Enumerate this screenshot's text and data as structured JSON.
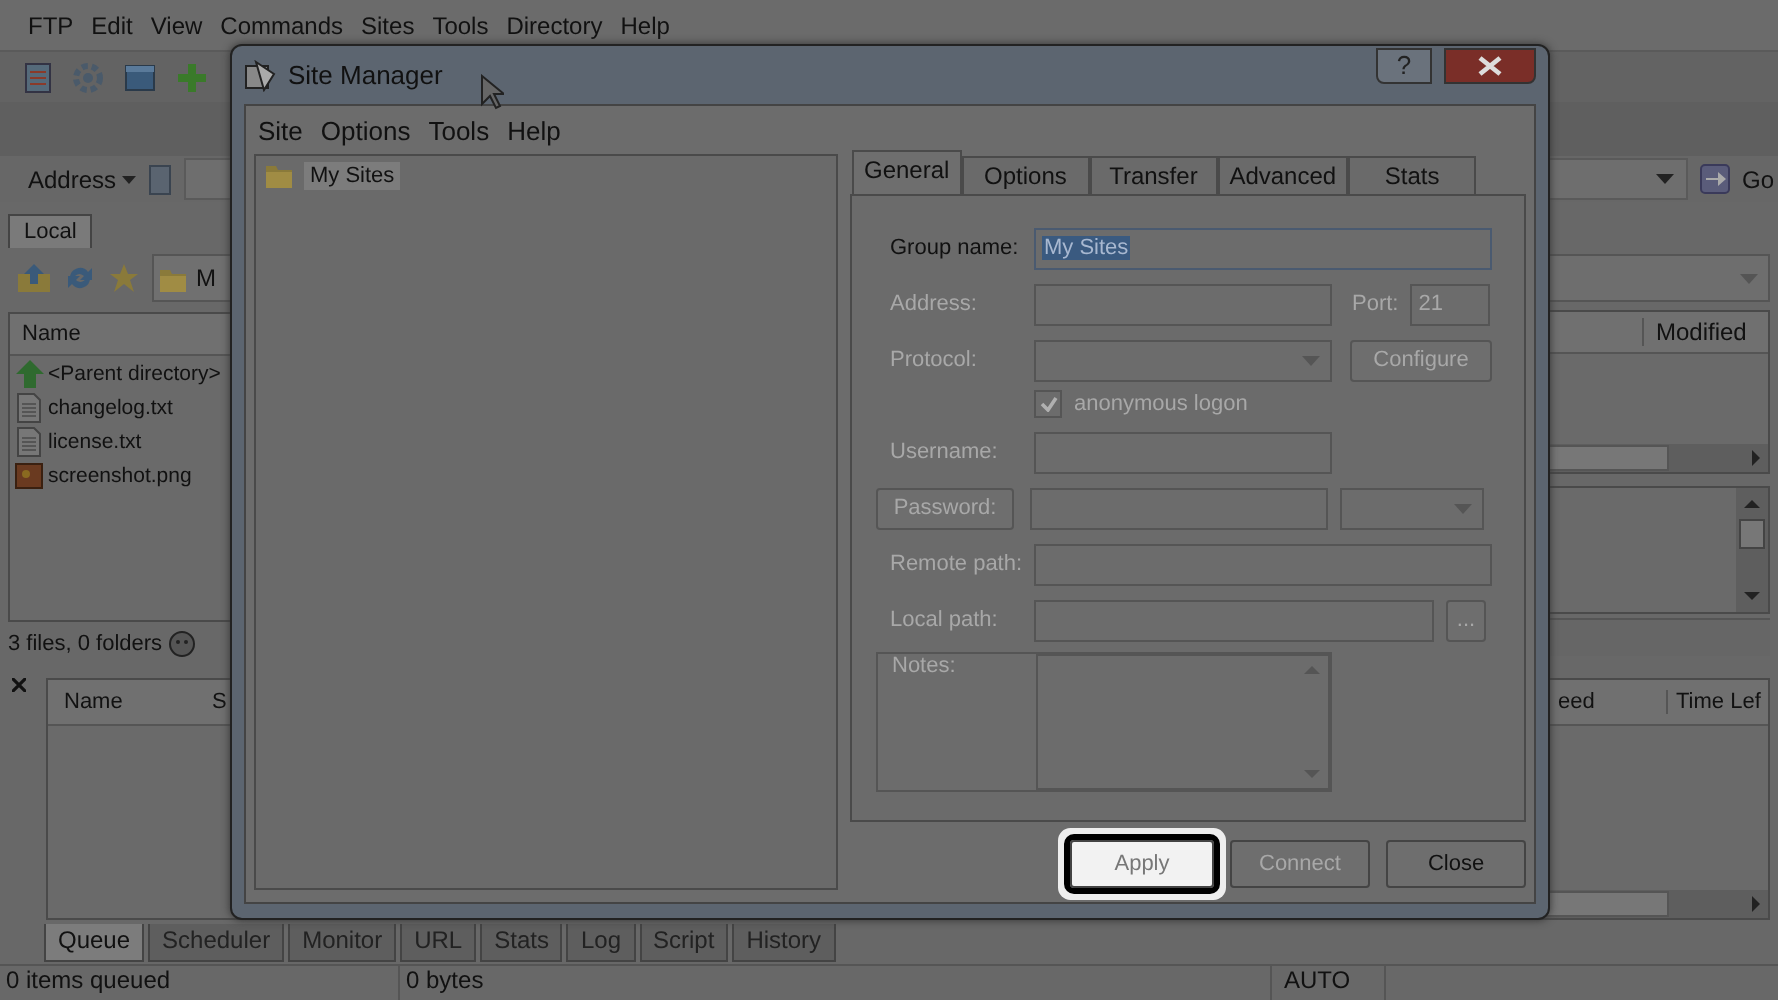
{
  "app": {
    "menu": [
      "FTP",
      "Edit",
      "View",
      "Commands",
      "Sites",
      "Tools",
      "Directory",
      "Help"
    ],
    "address": {
      "label": "Address",
      "go": "Go"
    },
    "local_tabs": [
      {
        "label": "Local",
        "selected": true
      }
    ],
    "local_folder": "M",
    "file_list": {
      "columns": [
        "Name"
      ],
      "rows": [
        {
          "name": "<Parent directory>",
          "kind": "up"
        },
        {
          "name": "changelog.txt",
          "kind": "text"
        },
        {
          "name": "license.txt",
          "kind": "text"
        },
        {
          "name": "screenshot.png",
          "kind": "image"
        }
      ]
    },
    "local_status": "3 files, 0 folders",
    "remote_list": {
      "columns": [
        "Modified"
      ]
    },
    "queue": {
      "columns_left": [
        "Name",
        "S"
      ],
      "columns_right": [
        "eed",
        "Time Lef"
      ]
    },
    "bottom_tabs": [
      {
        "label": "Queue",
        "selected": true
      },
      {
        "label": "Scheduler",
        "selected": false
      },
      {
        "label": "Monitor",
        "selected": false
      },
      {
        "label": "URL",
        "selected": false
      },
      {
        "label": "Stats",
        "selected": false
      },
      {
        "label": "Log",
        "selected": false
      },
      {
        "label": "Script",
        "selected": false
      },
      {
        "label": "History",
        "selected": false
      }
    ],
    "status_bar": [
      "0 items queued",
      "0 bytes",
      "AUTO"
    ]
  },
  "dialog": {
    "title": "Site Manager",
    "help_button": "?",
    "menu": [
      "Site",
      "Options",
      "Tools",
      "Help"
    ],
    "tree": [
      {
        "label": "My Sites",
        "selected": true
      }
    ],
    "tabs": [
      {
        "label": "General",
        "selected": true
      },
      {
        "label": "Options",
        "selected": false
      },
      {
        "label": "Transfer",
        "selected": false
      },
      {
        "label": "Advanced",
        "selected": false
      },
      {
        "label": "Stats",
        "selected": false
      }
    ],
    "fields": [
      {
        "kind": "text",
        "label": "Group name:",
        "value": "My Sites",
        "disabled": false
      },
      {
        "kind": "address",
        "label": "Address:",
        "port_label": "Port:",
        "port": "21",
        "disabled": true
      },
      {
        "kind": "protocol",
        "label": "Protocol:",
        "button": "Configure",
        "disabled": true
      },
      {
        "kind": "checkbox",
        "label": "anonymous logon",
        "checked": true,
        "disabled": true
      },
      {
        "kind": "short_text",
        "label": "Username:",
        "disabled": true
      },
      {
        "kind": "password",
        "label": "Password:",
        "disabled": true
      },
      {
        "kind": "text",
        "label": "Remote path:",
        "disabled": true
      },
      {
        "kind": "browse",
        "label": "Local path:",
        "button": "...",
        "disabled": true
      },
      {
        "kind": "notes",
        "label": "Notes:",
        "disabled": true
      }
    ],
    "buttons": [
      {
        "label": "Apply",
        "disabled": true,
        "highlighted": true
      },
      {
        "label": "Connect",
        "disabled": true,
        "highlighted": false
      },
      {
        "label": "Close",
        "disabled": false,
        "highlighted": false
      }
    ]
  }
}
